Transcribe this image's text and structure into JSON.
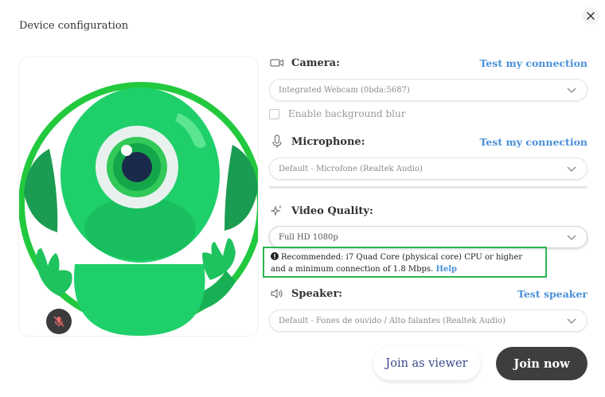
{
  "dialog": {
    "title": "Device configuration",
    "close_icon": "close-icon"
  },
  "camera": {
    "label": "Camera:",
    "icon": "video-camera-icon",
    "test_link": "Test my connection",
    "selected": "Integrated Webcam (0bda:5687)",
    "background_blur_label": "Enable background blur",
    "background_blur_checked": false
  },
  "microphone": {
    "label": "Microphone:",
    "icon": "microphone-icon",
    "test_link": "Test my connection",
    "selected": "Default - Microfone (Realtek Audio)"
  },
  "video_quality": {
    "label": "Video Quality:",
    "icon": "sparkle-icon",
    "selected": "Full HD 1080p",
    "notice_text": "Recommended: i7 Quad Core (physical core) CPU or higher and a minimum connection of 1.8 Mbps.",
    "notice_help": "Help",
    "notice_icon": "warning-icon"
  },
  "speaker": {
    "label": "Speaker:",
    "icon": "speaker-icon",
    "test_link": "Test speaker",
    "selected": "Default - Fones de ouvido / Alto falantes (Realtek Audio)"
  },
  "actions": {
    "join_viewer": "Join as viewer",
    "join_now": "Join now"
  },
  "preview": {
    "mic_toggle_icon": "microphone-muted-icon",
    "camera_toggle_icon": "camera-off-icon"
  },
  "colors": {
    "accent_link": "#4a90d9",
    "highlight_border": "#2ab550",
    "mascot_green": "#1fd06a",
    "join_button": "#3e3e3e"
  }
}
